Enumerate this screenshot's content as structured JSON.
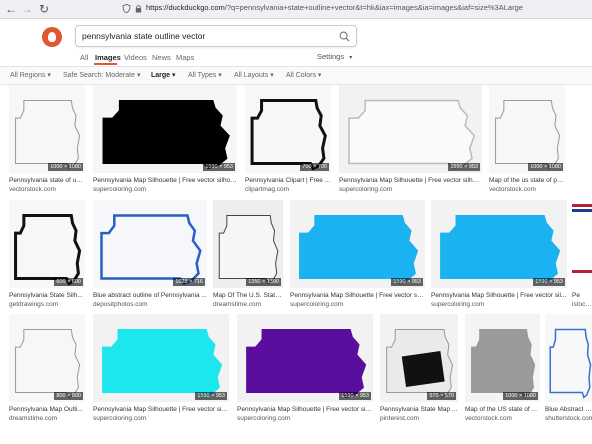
{
  "browser": {
    "url_host": "https://duckduckgo.com",
    "url_path": "/?q=pennsylvania+state+outline+vector&t=hk&iax=images&ia=images&iaf=size%3ALarge"
  },
  "search": {
    "query": "pennsylvania state outline vector"
  },
  "tabs": [
    "All",
    "Images",
    "Videos",
    "News",
    "Maps"
  ],
  "settings_label": "Settings",
  "filters": [
    "All Regions",
    "Safe Search: Moderate",
    "Large",
    "All Types",
    "All Layouts",
    "All Colors"
  ],
  "colors": {
    "brand": "#de5833",
    "blue": "#1ab2f0",
    "cyan": "#1ee6ee",
    "purple": "#5a0e9e"
  },
  "results": [
    {
      "title": "Pennsylvania state of us ...",
      "source": "vectorstock.com",
      "size": "1000 × 1080"
    },
    {
      "title": "Pennsylvania Map Silhouette | Free vector silhou...",
      "source": "supercoloring.com",
      "size": "1590 × 953"
    },
    {
      "title": "Pennsylvania Clipart | Free ...",
      "source": "clipartmag.com",
      "size": "700 × 700"
    },
    {
      "title": "Pennsylvania Map Silhouette | Free vector silhou...",
      "source": "supercoloring.com",
      "size": "1590 × 953"
    },
    {
      "title": "Map of the us state of pe...",
      "source": "vectorstock.com",
      "size": "1000 × 1080"
    },
    {
      "title": "Pennsylvania State Silh...",
      "source": "getdrawings.com",
      "size": "600 × 600"
    },
    {
      "title": "Blue abstract outline of Pennsylvania ...",
      "source": "depositphotos.com",
      "size": "1023 × 716"
    },
    {
      "title": "Map Of The U.S. State ...",
      "source": "dreamstime.com",
      "size": "1350 × 1390"
    },
    {
      "title": "Pennsylvania Map Silhouette | Free vector sil...",
      "source": "supercoloring.com",
      "size": "1590 × 953"
    },
    {
      "title": "Pennsylvania Map Silhouette | Free vector sil...",
      "source": "supercoloring.com",
      "size": "1590 × 953"
    },
    {
      "title": "Pe",
      "source": "istockph",
      "size": ""
    },
    {
      "title": "Pennsylvania Map Outli...",
      "source": "dreamstime.com",
      "size": "800 × 800"
    },
    {
      "title": "Pennsylvania Map Silhouette | Free vector silh...",
      "source": "supercoloring.com",
      "size": "1590 × 953"
    },
    {
      "title": "Pennsylvania Map Silhouette | Free vector silh...",
      "source": "supercoloring.com",
      "size": "1590 × 953"
    },
    {
      "title": "Pennsylvania State Map ...",
      "source": "pinterest.com",
      "size": "570 × 570"
    },
    {
      "title": "Map of the US state of ...",
      "source": "vectorstock.com",
      "size": "1000 × 1080"
    },
    {
      "title": "Blue Abstract Ou...",
      "source": "shutterstock.com",
      "size": ""
    }
  ]
}
